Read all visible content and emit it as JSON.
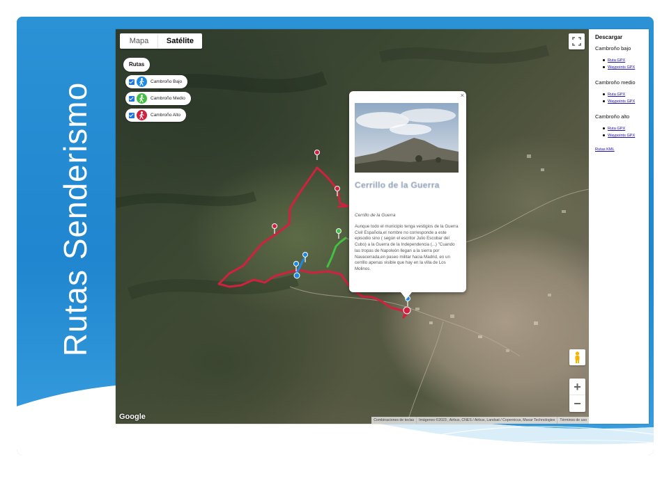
{
  "slide": {
    "title": "Rutas Senderismo"
  },
  "map": {
    "type_buttons": {
      "map": "Mapa",
      "satellite": "Satélite",
      "selected": "satellite"
    },
    "routes_panel": {
      "title": "Rutas",
      "items": [
        {
          "label": "Cambroño Bajo",
          "checked": true,
          "color": "#1e88e5"
        },
        {
          "label": "Cambroño Medio",
          "checked": true,
          "color": "#43c043"
        },
        {
          "label": "Cambroño Alto",
          "checked": true,
          "color": "#d0213f"
        }
      ]
    },
    "info_window": {
      "close": "×",
      "title": "Cerrillo de la Guerra",
      "subtitle": "Cerrillo de la Guerra",
      "text": "Aunque todo el municipio tenga vestigios de la Guerra Civil Española,el nombre no corresponde a este episodio sino ( según el escritor Julio Escobar del Cubo) a la Guerra de la Independencia (...) \"Cuando las tropas de Napoleón llegan a la sierra por Navacerrada,en paseo militar hacia Madrid, en un cerrillo apenas visible que hay en la villa de Los Molinos."
    },
    "zoom": {
      "in": "+",
      "out": "−"
    },
    "logo": "Google",
    "attribution": [
      "Combinaciones de teclas",
      "Imágenes ©2023 , Airbus, CNES / Airbus, Landsat / Copernicus, Maxar Technologies",
      "Términos de uso"
    ]
  },
  "sidebar": {
    "title": "Descargar",
    "groups": [
      {
        "name": "Cambroño bajo",
        "links": [
          "Ruta GPX",
          "Waypoints GPX"
        ]
      },
      {
        "name": "Cambroño medio",
        "links": [
          "Ruta GPX",
          "Waypoints GPX"
        ]
      },
      {
        "name": "Cambroño alto",
        "links": [
          "Ruta GPX",
          "Waypoints GPX"
        ]
      }
    ],
    "kml_link": "Rutas KML"
  },
  "colors": {
    "banner": "#1f86cf",
    "route_high": "#d0213f",
    "route_mid": "#43c043",
    "route_low": "#1e88e5",
    "link": "#1a0dab"
  },
  "icons": [
    "fullscreen-icon",
    "pegman-icon",
    "hiker-icon",
    "map-pin-icon",
    "checkbox-icon"
  ]
}
